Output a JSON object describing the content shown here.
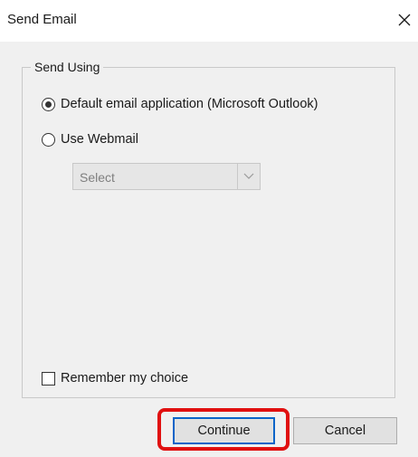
{
  "dialog": {
    "title": "Send Email",
    "close_icon": "close-icon",
    "group_label": "Send Using",
    "options": [
      {
        "label": "Default email application (Microsoft Outlook)",
        "checked": true
      },
      {
        "label": "Use Webmail",
        "checked": false
      }
    ],
    "webmail_select": {
      "value": "Select",
      "enabled": false
    },
    "remember_label": "Remember my choice",
    "remember_checked": false,
    "buttons": {
      "continue": "Continue",
      "cancel": "Cancel"
    },
    "colors": {
      "highlight": "#e01010",
      "default_button_border": "#0a64c8",
      "dialog_bg": "#f0f0f0"
    }
  }
}
